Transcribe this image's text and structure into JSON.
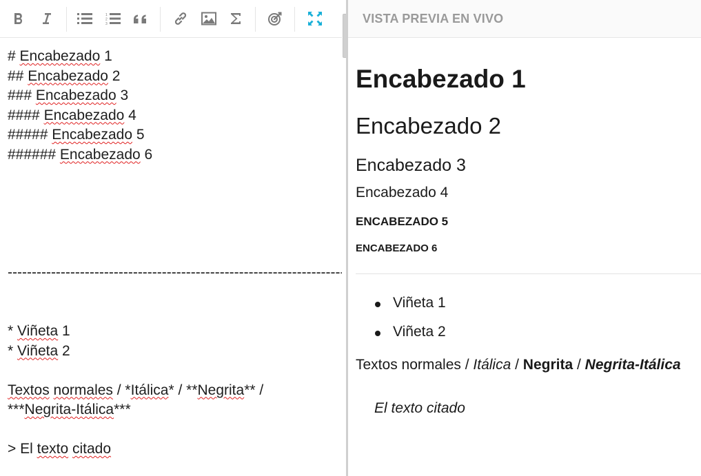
{
  "toolbar": {
    "buttons": [
      "bold-icon",
      "italic-icon",
      "unordered-list-icon",
      "ordered-list-icon",
      "quote-icon",
      "link-icon",
      "image-icon",
      "sigma-icon",
      "target-icon",
      "fullscreen-icon"
    ],
    "accent_color": "#1ab0d8",
    "icon_color": "#7a7a7a"
  },
  "editor": {
    "lines": [
      [
        {
          "t": "# "
        },
        {
          "t": "Encabezado",
          "sp": true
        },
        {
          "t": " 1"
        }
      ],
      [
        {
          "t": "## "
        },
        {
          "t": "Encabezado",
          "sp": true
        },
        {
          "t": " 2"
        }
      ],
      [
        {
          "t": "### "
        },
        {
          "t": "Encabezado",
          "sp": true
        },
        {
          "t": " 3"
        }
      ],
      [
        {
          "t": "#### "
        },
        {
          "t": "Encabezado",
          "sp": true
        },
        {
          "t": " 4"
        }
      ],
      [
        {
          "t": "##### "
        },
        {
          "t": "Encabezado",
          "sp": true
        },
        {
          "t": " 5"
        }
      ],
      [
        {
          "t": "###### "
        },
        {
          "t": "Encabezado",
          "sp": true
        },
        {
          "t": " 6"
        }
      ],
      [],
      [],
      [],
      [],
      [],
      [
        {
          "t": "-----------------------------------------------------------------------"
        }
      ],
      [],
      [],
      [
        {
          "t": "* "
        },
        {
          "t": "Viñeta",
          "sp": true
        },
        {
          "t": " 1"
        }
      ],
      [
        {
          "t": "* "
        },
        {
          "t": "Viñeta",
          "sp": true
        },
        {
          "t": " 2"
        }
      ],
      [],
      [
        {
          "t": "Textos",
          "sp": true
        },
        {
          "t": " "
        },
        {
          "t": "normales",
          "sp": true
        },
        {
          "t": " / *"
        },
        {
          "t": "Itálica",
          "sp": true
        },
        {
          "t": "* / **"
        },
        {
          "t": "Negrita",
          "sp": true
        },
        {
          "t": "** /"
        }
      ],
      [
        {
          "t": "***"
        },
        {
          "t": "Negrita-Itálica",
          "sp": true
        },
        {
          "t": "***"
        }
      ],
      [],
      [
        {
          "t": "> El "
        },
        {
          "t": "texto",
          "sp": true
        },
        {
          "t": " "
        },
        {
          "t": "citado",
          "sp": true
        }
      ]
    ]
  },
  "preview": {
    "title": "VISTA PREVIA EN VIVO",
    "h1": "Encabezado 1",
    "h2": "Encabezado 2",
    "h3": "Encabezado 3",
    "h4": "Encabezado 4",
    "h5": "Encabezado 5",
    "h6": "Encabezado 6",
    "bullets": [
      "Viñeta 1",
      "Viñeta 2"
    ],
    "paragraph": {
      "normal": "Textos normales",
      "sep": " / ",
      "italic": "Itálica",
      "bold": "Negrita",
      "bold_italic": "Negrita-Itálica"
    },
    "quote": "El texto citado"
  }
}
